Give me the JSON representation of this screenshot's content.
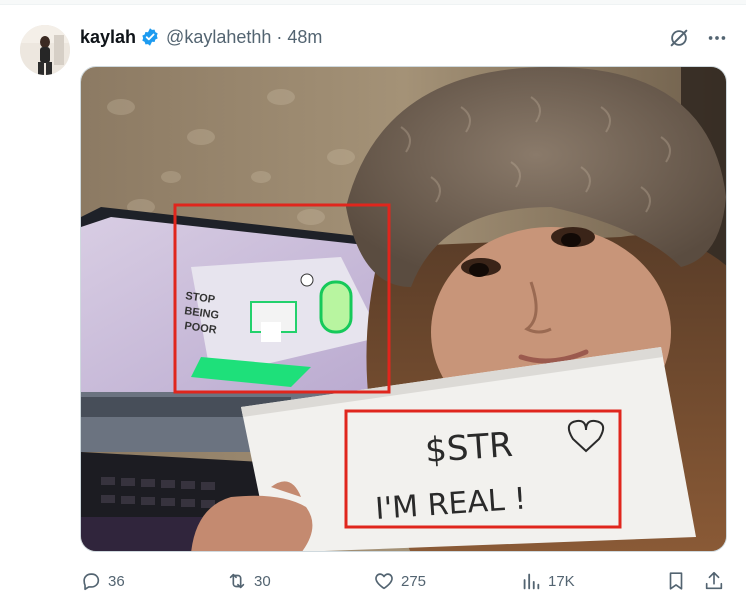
{
  "author": {
    "display_name": "kaylah",
    "handle": "@kaylahethh",
    "time": "48m",
    "verified": true
  },
  "media": {
    "sign_text_line1": "$STR",
    "sign_text_line2": "I'M REAL !",
    "monitor_text_line1": "STOP",
    "monitor_text_line2": "BEING",
    "monitor_text_line3": "POOR",
    "highlight_color": "#e0261d"
  },
  "stats": {
    "replies": "36",
    "reposts": "30",
    "likes": "275",
    "views": "17K"
  },
  "icons": {
    "verified": "verified-badge-icon",
    "grok": "grok-icon",
    "more": "more-icon",
    "reply": "reply-icon",
    "repost": "repost-icon",
    "like": "heart-icon",
    "views": "views-icon",
    "bookmark": "bookmark-icon",
    "share": "share-icon"
  },
  "colors": {
    "text_primary": "#0f1419",
    "text_secondary": "#536471",
    "verified_blue": "#1d9bf0"
  }
}
